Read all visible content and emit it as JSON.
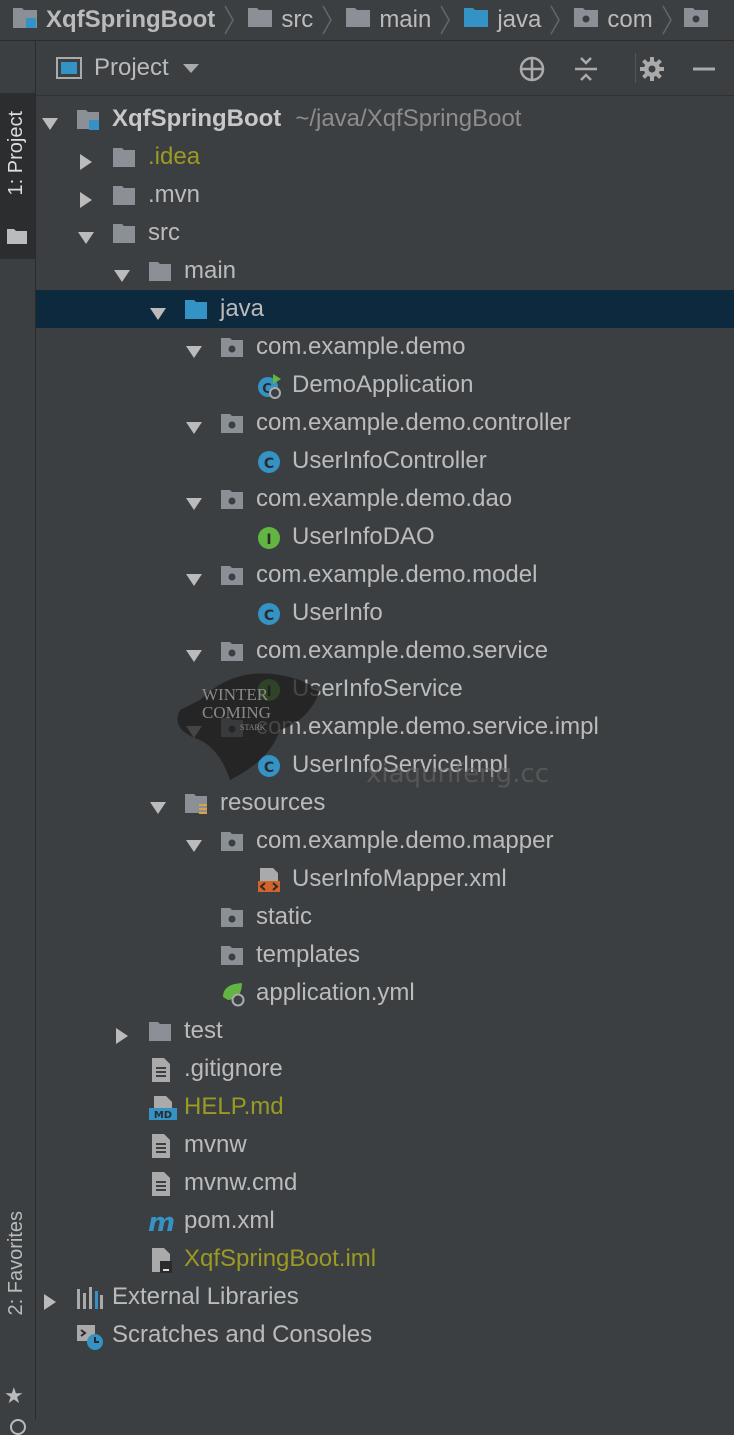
{
  "breadcrumb": [
    {
      "label": "XqfSpringBoot",
      "icon": "module-icon"
    },
    {
      "label": "src",
      "icon": "folder-icon"
    },
    {
      "label": "main",
      "icon": "folder-icon"
    },
    {
      "label": "java",
      "icon": "source-folder-icon"
    },
    {
      "label": "com",
      "icon": "package-icon"
    }
  ],
  "stripe": {
    "project_tab": "1: Project",
    "favorites_tab": "2: Favorites"
  },
  "panel": {
    "title": "Project"
  },
  "tree": [
    {
      "label": "XqfSpringBoot",
      "path": "~/java/XqfSpringBoot",
      "indent": 0,
      "arrow": "down",
      "icon": "module"
    },
    {
      "label": ".idea",
      "indent": 1,
      "arrow": "right",
      "icon": "folder",
      "color": "yellow"
    },
    {
      "label": ".mvn",
      "indent": 1,
      "arrow": "right",
      "icon": "folder"
    },
    {
      "label": "src",
      "indent": 1,
      "arrow": "down",
      "icon": "folder"
    },
    {
      "label": "main",
      "indent": 2,
      "arrow": "down",
      "icon": "folder"
    },
    {
      "label": "java",
      "indent": 3,
      "arrow": "down",
      "icon": "source-folder",
      "selected": true
    },
    {
      "label": "com.example.demo",
      "indent": 4,
      "arrow": "down",
      "icon": "package"
    },
    {
      "label": "DemoApplication",
      "indent": 5,
      "arrow": "none",
      "icon": "spring-app-class"
    },
    {
      "label": "com.example.demo.controller",
      "indent": 4,
      "arrow": "down",
      "icon": "package"
    },
    {
      "label": "UserInfoController",
      "indent": 5,
      "arrow": "none",
      "icon": "class"
    },
    {
      "label": "com.example.demo.dao",
      "indent": 4,
      "arrow": "down",
      "icon": "package"
    },
    {
      "label": "UserInfoDAO",
      "indent": 5,
      "arrow": "none",
      "icon": "interface"
    },
    {
      "label": "com.example.demo.model",
      "indent": 4,
      "arrow": "down",
      "icon": "package"
    },
    {
      "label": "UserInfo",
      "indent": 5,
      "arrow": "none",
      "icon": "class"
    },
    {
      "label": "com.example.demo.service",
      "indent": 4,
      "arrow": "down",
      "icon": "package"
    },
    {
      "label": "UserInfoService",
      "indent": 5,
      "arrow": "none",
      "icon": "interface"
    },
    {
      "label": "com.example.demo.service.impl",
      "indent": 4,
      "arrow": "down",
      "icon": "package"
    },
    {
      "label": "UserInfoServiceImpl",
      "indent": 5,
      "arrow": "none",
      "icon": "class"
    },
    {
      "label": "resources",
      "indent": 3,
      "arrow": "down",
      "icon": "resources-folder"
    },
    {
      "label": "com.example.demo.mapper",
      "indent": 4,
      "arrow": "down",
      "icon": "package"
    },
    {
      "label": "UserInfoMapper.xml",
      "indent": 5,
      "arrow": "none",
      "icon": "xml-file"
    },
    {
      "label": "static",
      "indent": 4,
      "arrow": "none",
      "icon": "package"
    },
    {
      "label": "templates",
      "indent": 4,
      "arrow": "none",
      "icon": "package"
    },
    {
      "label": "application.yml",
      "indent": 4,
      "arrow": "none",
      "icon": "spring-yml"
    },
    {
      "label": "test",
      "indent": 2,
      "arrow": "right",
      "icon": "folder"
    },
    {
      "label": ".gitignore",
      "indent": 2,
      "arrow": "none",
      "icon": "text-file"
    },
    {
      "label": "HELP.md",
      "indent": 2,
      "arrow": "none",
      "icon": "md-file",
      "color": "yellow"
    },
    {
      "label": "mvnw",
      "indent": 2,
      "arrow": "none",
      "icon": "text-file"
    },
    {
      "label": "mvnw.cmd",
      "indent": 2,
      "arrow": "none",
      "icon": "text-file"
    },
    {
      "label": "pom.xml",
      "indent": 2,
      "arrow": "none",
      "icon": "maven"
    },
    {
      "label": "XqfSpringBoot.iml",
      "indent": 2,
      "arrow": "none",
      "icon": "iml-file",
      "color": "yellow"
    },
    {
      "label": "External Libraries",
      "indent": 0,
      "arrow": "right",
      "icon": "libraries"
    },
    {
      "label": "Scratches and Consoles",
      "indent": 0,
      "arrow": "none",
      "icon": "scratches"
    }
  ],
  "watermark": {
    "badge_line1": "WINTER",
    "badge_line2": "COMING",
    "badge_line3": "STARK",
    "site": "xiaqunfeng.cc"
  },
  "colors": {
    "background": "#3c3f41",
    "selection": "#0d293e",
    "folder": "#8a9096",
    "source_folder": "#3592c4",
    "class": "#3592c4",
    "interface": "#62b543",
    "modified": "#9b9a22"
  }
}
